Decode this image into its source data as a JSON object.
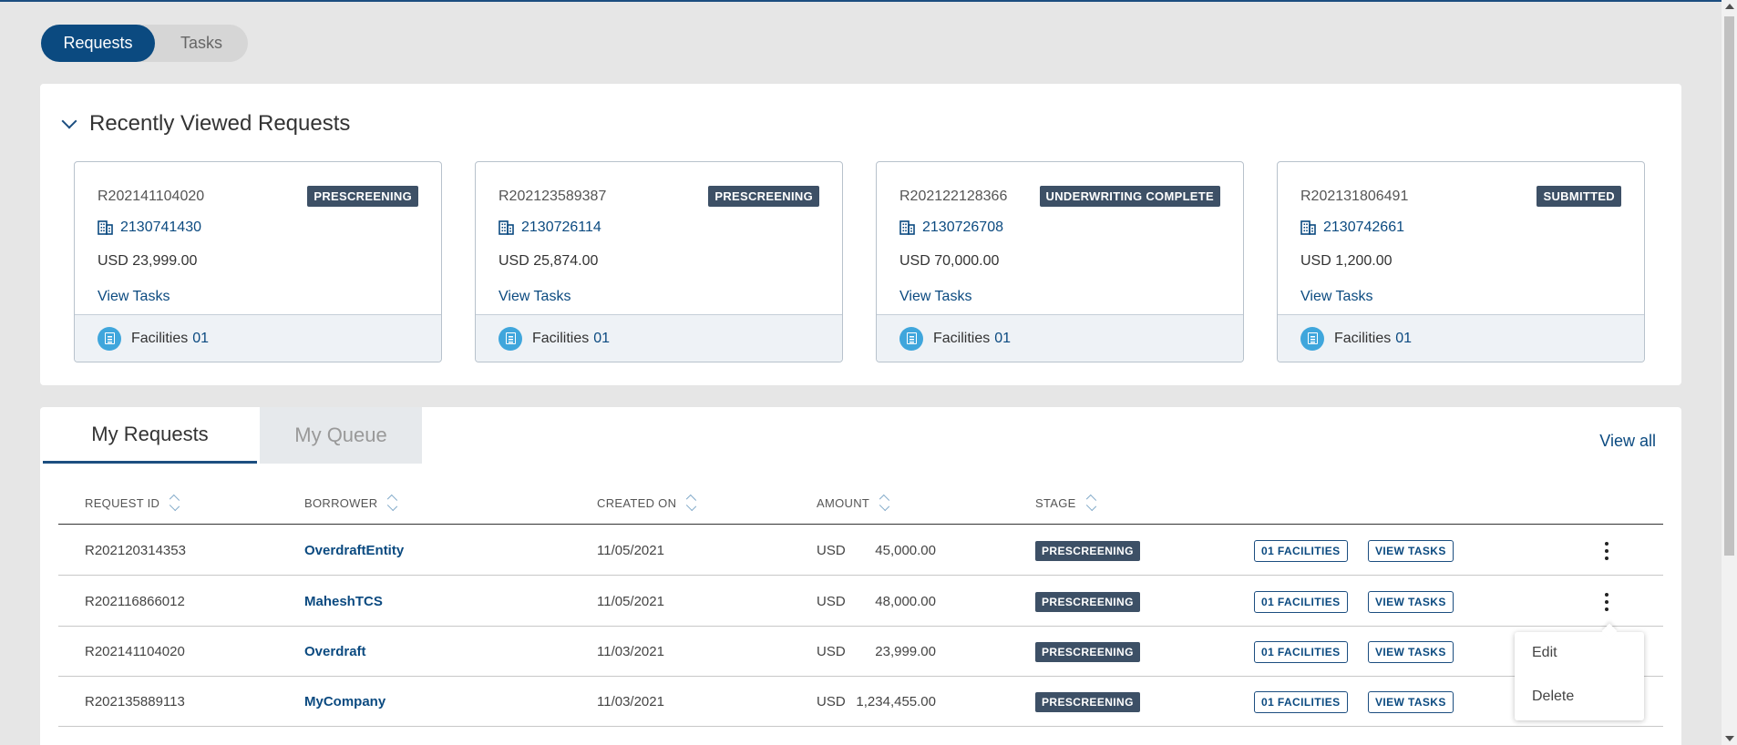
{
  "toggle": {
    "requests": "Requests",
    "tasks": "Tasks"
  },
  "recent": {
    "title": "Recently Viewed Requests",
    "cards": [
      {
        "id": "R202141104020",
        "stage": "PRESCREENING",
        "account": "2130741430",
        "amount": "USD 23,999.00",
        "view_tasks": "View Tasks",
        "facilities_label": "Facilities",
        "facilities_count": "01"
      },
      {
        "id": "R202123589387",
        "stage": "PRESCREENING",
        "account": "2130726114",
        "amount": "USD 25,874.00",
        "view_tasks": "View Tasks",
        "facilities_label": "Facilities",
        "facilities_count": "01"
      },
      {
        "id": "R202122128366",
        "stage": "UNDERWRITING COMPLETE",
        "account": "2130726708",
        "amount": "USD 70,000.00",
        "view_tasks": "View Tasks",
        "facilities_label": "Facilities",
        "facilities_count": "01"
      },
      {
        "id": "R202131806491",
        "stage": "SUBMITTED",
        "account": "2130742661",
        "amount": "USD 1,200.00",
        "view_tasks": "View Tasks",
        "facilities_label": "Facilities",
        "facilities_count": "01"
      }
    ]
  },
  "requests": {
    "tab_my": "My Requests",
    "tab_queue": "My Queue",
    "view_all": "View all",
    "columns": {
      "request_id": "REQUEST ID",
      "borrower": "BORROWER",
      "created_on": "CREATED ON",
      "amount": "AMOUNT",
      "stage": "STAGE"
    },
    "rows": [
      {
        "id": "R202120314353",
        "borrower": "OverdraftEntity",
        "created": "11/05/2021",
        "currency": "USD",
        "amount": "45,000.00",
        "stage": "PRESCREENING",
        "facilities": "01 FACILITIES",
        "view_tasks": "VIEW TASKS"
      },
      {
        "id": "R202116866012",
        "borrower": "MaheshTCS",
        "created": "11/05/2021",
        "currency": "USD",
        "amount": "48,000.00",
        "stage": "PRESCREENING",
        "facilities": "01 FACILITIES",
        "view_tasks": "VIEW TASKS"
      },
      {
        "id": "R202141104020",
        "borrower": "Overdraft",
        "created": "11/03/2021",
        "currency": "USD",
        "amount": "23,999.00",
        "stage": "PRESCREENING",
        "facilities": "01 FACILITIES",
        "view_tasks": "VIEW TASKS"
      },
      {
        "id": "R202135889113",
        "borrower": "MyCompany",
        "created": "11/03/2021",
        "currency": "USD",
        "amount": "1,234,455.00",
        "stage": "PRESCREENING",
        "facilities": "01 FACILITIES",
        "view_tasks": "VIEW TASKS"
      }
    ]
  },
  "context_menu": {
    "edit": "Edit",
    "delete": "Delete"
  },
  "icons": {
    "collapse": "chevron-down-icon",
    "account": "building-icon",
    "facilities": "document-icon",
    "row_menu": "kebab-menu-icon"
  },
  "colors": {
    "primary": "#0b4a80",
    "badge": "#3d5066",
    "facility_icon": "#3fa6dc"
  }
}
